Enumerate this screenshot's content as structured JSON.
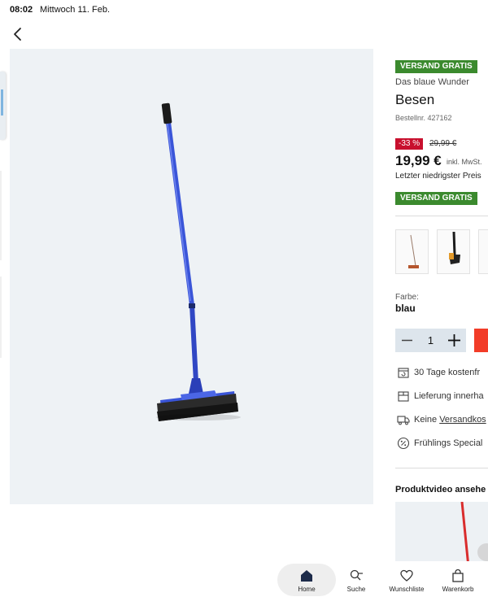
{
  "status_bar": {
    "time": "08:02",
    "date": "Mittwoch 11. Feb."
  },
  "product": {
    "badge_top": "VERSAND GRATIS",
    "brand": "Das blaue Wunder",
    "title": "Besen",
    "sku": "Bestellnr. 427162",
    "discount": "-33 %",
    "old_price": "29,99 €",
    "price": "19,99 €",
    "tax_note": "inkl. MwSt.",
    "lowest_price_note": "Letzter niedrigster Preis",
    "badge_bottom": "VERSAND GRATIS",
    "color_label": "Farbe:",
    "color_value": "blau",
    "quantity": "1"
  },
  "features": [
    {
      "icon": "calendar-return-icon",
      "text": "30 Tage kostenfr"
    },
    {
      "icon": "package-icon",
      "text": "Lieferung innerha"
    },
    {
      "icon": "truck-icon",
      "text_prefix": "Keine ",
      "text_link": "Versandkos"
    },
    {
      "icon": "percent-icon",
      "text": "Frühlings Special"
    }
  ],
  "video_heading": "Produktvideo ansehe",
  "bottom_nav": [
    {
      "id": "home",
      "label": "Home",
      "icon": "home-icon",
      "active": true
    },
    {
      "id": "search",
      "label": "Suche",
      "icon": "search-icon",
      "active": false
    },
    {
      "id": "wishlist",
      "label": "Wunschliste",
      "icon": "heart-icon",
      "active": false
    },
    {
      "id": "cart",
      "label": "Warenkorb",
      "icon": "shopping-bag-icon",
      "active": false
    }
  ],
  "colors": {
    "badge_green": "#3b8a2e",
    "discount_red": "#c8102e",
    "cta_red": "#f23c28",
    "broom_blue": "#3a55d8",
    "image_bg": "#eef2f5"
  }
}
